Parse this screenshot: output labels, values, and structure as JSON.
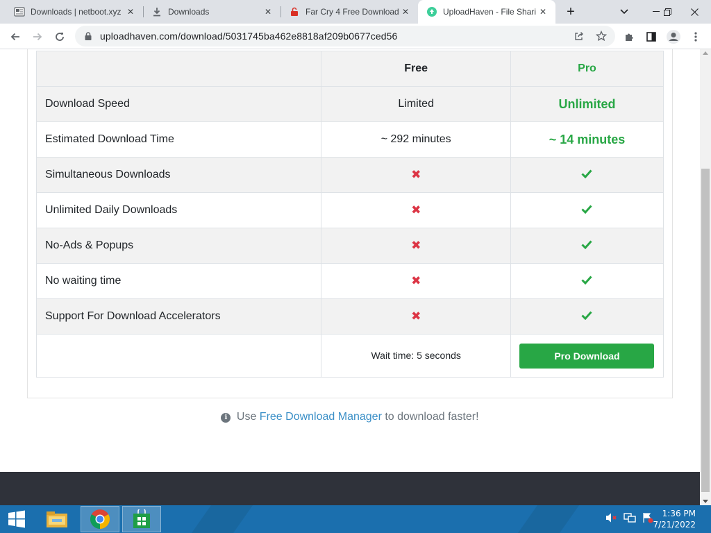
{
  "browser": {
    "tabs": [
      {
        "label": "Downloads | netboot.xyz",
        "icon": "netboot-favicon"
      },
      {
        "label": "Downloads",
        "icon": "download-icon"
      },
      {
        "label": "Far Cry 4 Free Download",
        "icon": "unlock-icon"
      },
      {
        "label": "UploadHaven - File Shari",
        "icon": "uploadhaven-favicon",
        "active": true
      }
    ],
    "url": "uploadhaven.com/download/5031745ba462e8818af209b0677ced56"
  },
  "comparison": {
    "header": {
      "free": "Free",
      "pro": "Pro"
    },
    "rows": [
      {
        "feature": "Download Speed",
        "free": "Limited",
        "pro": "Unlimited"
      },
      {
        "feature": "Estimated Download Time",
        "free": "~ 292 minutes",
        "pro": "~ 14 minutes"
      },
      {
        "feature": "Simultaneous Downloads",
        "free": "no",
        "pro": "yes"
      },
      {
        "feature": "Unlimited Daily Downloads",
        "free": "no",
        "pro": "yes"
      },
      {
        "feature": "No-Ads & Popups",
        "free": "no",
        "pro": "yes"
      },
      {
        "feature": "No waiting time",
        "free": "no",
        "pro": "yes"
      },
      {
        "feature": "Support For Download Accelerators",
        "free": "no",
        "pro": "yes"
      }
    ],
    "wait_text": "Wait time: 5 seconds",
    "pro_button": "Pro Download"
  },
  "hint": {
    "prefix": "Use",
    "link": "Free Download Manager",
    "suffix": "to download faster!"
  },
  "taskbar": {
    "time": "1:36 PM",
    "date": "7/21/2022"
  },
  "colors": {
    "pro_green": "#28a745",
    "cross_red": "#dc3545",
    "link_blue": "#3a8fc7",
    "taskbar_blue": "#1b6fae"
  }
}
